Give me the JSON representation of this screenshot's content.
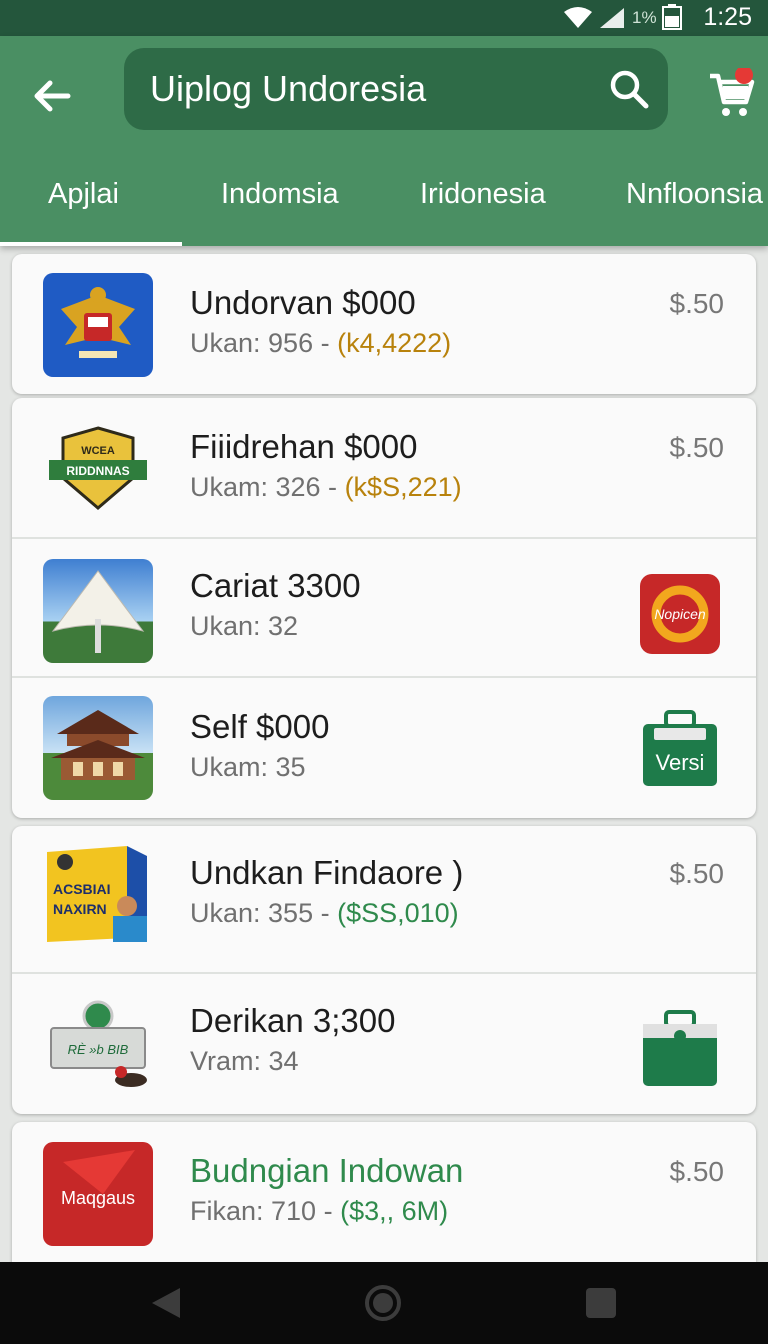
{
  "status_bar": {
    "time": "1:25",
    "battery_text": "1%",
    "icons": [
      "wifi-icon",
      "signal-icon",
      "battery-icon"
    ]
  },
  "header": {
    "back_icon": "arrow-left-icon",
    "search_query": "Uiplog Undoresia",
    "search_icon": "search-icon",
    "cart_icon": "cart-icon",
    "tabs": [
      {
        "label": "Apjlai",
        "selected": true
      },
      {
        "label": "Indomsia",
        "selected": false
      },
      {
        "label": "Iridonesia",
        "selected": false
      },
      {
        "label": "Nnfloonsia",
        "selected": false
      }
    ]
  },
  "items": [
    {
      "title": "Undorvan $000",
      "sub_prefix": "Ukan: 956 - ",
      "sub_highlight": "(k4,4222)",
      "price": "$.50",
      "thumb": "garuda-emblem"
    },
    {
      "title": "Fiiidrehan $000",
      "sub_prefix": "Ukam: 326 - ",
      "sub_highlight": "(k$S,221)",
      "price": "$.50",
      "thumb": "badge-logo",
      "badge_text": [
        "WCEA",
        "RIDDNNAS"
      ]
    },
    {
      "title": "Cariat 3300",
      "sub_prefix": "Ukan: 32",
      "thumb": "tent-photo",
      "action_icon": "app-badge-icon",
      "action_text": "Nopicen"
    },
    {
      "title": "Self $000",
      "sub_prefix": "Ukam: 35",
      "thumb": "temple-photo",
      "action_icon": "briefcase-icon",
      "action_text": "Versi"
    },
    {
      "title": "Undkan Findaore )",
      "sub_prefix": "Ukan: 355 - ",
      "sub_highlight": "($SS,010)",
      "price": "$.50",
      "thumb": "product-box",
      "box_text": [
        "ACSBIAI",
        "NAXIRN"
      ]
    },
    {
      "title": "Derikan 3;300",
      "sub_prefix": "Vram: 34",
      "thumb": "sign-board",
      "board_text": "RÈ »b BIB",
      "action_icon": "briefcase-icon"
    },
    {
      "title": "Budngian Indowan",
      "sub_prefix": "Fikan: 710 - ",
      "sub_highlight": "($3,, 6M)",
      "price": "$.50",
      "thumb": "red-app-logo",
      "logo_text": "Maqgaus"
    }
  ],
  "nav_bar": {
    "icons": [
      "back-triangle-icon",
      "home-circle-icon",
      "recents-square-icon"
    ]
  },
  "colors": {
    "header": "#4a8f63",
    "status": "#24563c",
    "search": "#2e6b47",
    "accent_green": "#2f8a4c",
    "accent_orange": "#b8820c",
    "cart_dot": "#e53935"
  }
}
